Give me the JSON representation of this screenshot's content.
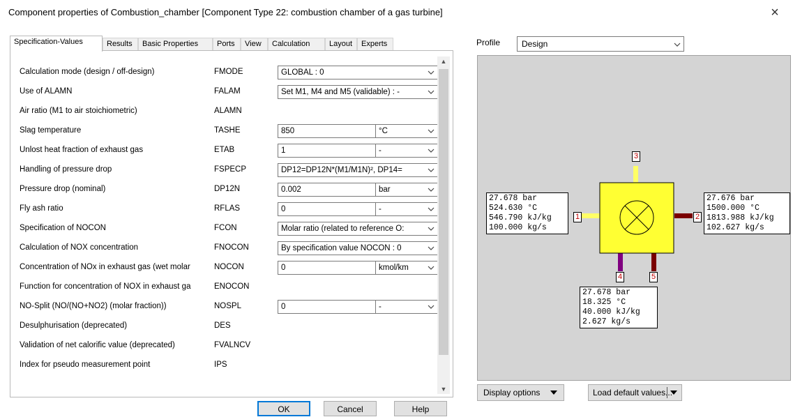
{
  "window": {
    "title": "Component properties of Combustion_chamber  [Component Type 22: combustion chamber of a gas turbine]",
    "close_glyph": "×"
  },
  "tabs": [
    {
      "label": "Specification-Values",
      "active": true
    },
    {
      "label": "Results"
    },
    {
      "label": "Basic Properties"
    },
    {
      "label": "Ports"
    },
    {
      "label": "View"
    },
    {
      "label": "Calculation"
    },
    {
      "label": "Layout"
    },
    {
      "label": "Experts"
    }
  ],
  "properties": [
    {
      "label": "Calculation mode (design / off-design)",
      "code": "FMODE",
      "value": "GLOBAL : 0",
      "kind": "combo"
    },
    {
      "label": "Use of ALAMN",
      "code": "FALAM",
      "value": "Set M1, M4 and M5 (validable) : -",
      "kind": "combo"
    },
    {
      "label": "Air ratio (M1 to air stoichiometric)",
      "code": "ALAMN",
      "value": "",
      "kind": "none"
    },
    {
      "label": "Slag temperature",
      "code": "TASHE",
      "value": "850",
      "unit": "°C",
      "kind": "unit"
    },
    {
      "label": "Unlost heat fraction of exhaust gas",
      "code": "ETAB",
      "value": "1",
      "unit": "-",
      "kind": "unit"
    },
    {
      "label": "Handling of pressure drop",
      "code": "FSPECP",
      "value": "DP12=DP12N*(M1/M1N)², DP14=",
      "kind": "combo"
    },
    {
      "label": "Pressure drop (nominal)",
      "code": "DP12N",
      "value": "0.002",
      "unit": "bar",
      "kind": "unit"
    },
    {
      "label": "Fly ash ratio",
      "code": "RFLAS",
      "value": "0",
      "unit": "-",
      "kind": "unit"
    },
    {
      "label": "Specification of NOCON",
      "code": "FCON",
      "value": "Molar ratio (related to reference O:",
      "kind": "combo"
    },
    {
      "label": "Calculation of NOX concentration",
      "code": "FNOCON",
      "value": "By specification value NOCON : 0",
      "kind": "combo"
    },
    {
      "label": "Concentration of NOx in exhaust gas (wet molar",
      "code": "NOCON",
      "value": "0",
      "unit": "kmol/km",
      "kind": "unit"
    },
    {
      "label": "Function for concentration of NOX in exhaust ga",
      "code": "ENOCON",
      "value": "",
      "kind": "none"
    },
    {
      "label": "NO-Split (NO/(NO+NO2)  (molar fraction))",
      "code": "NOSPL",
      "value": "0",
      "unit": "-",
      "kind": "unit"
    },
    {
      "label": "Desulphurisation (deprecated)",
      "code": "DES",
      "value": "",
      "kind": "none"
    },
    {
      "label": "Validation of net calorific value (deprecated)",
      "code": "FVALNCV",
      "value": "",
      "kind": "none"
    },
    {
      "label": "Index for pseudo measurement point",
      "code": "IPS",
      "value": "",
      "kind": "none"
    }
  ],
  "buttons": {
    "ok": "OK",
    "cancel": "Cancel",
    "help": "Help"
  },
  "profile": {
    "label": "Profile",
    "value": "Design"
  },
  "diagram": {
    "component_color": "#ffff33",
    "port1_box": [
      "27.678 bar",
      "524.630 °C",
      "546.790 kJ/kg",
      "100.000 kg/s"
    ],
    "port2_box": [
      "27.676 bar",
      "1500.000 °C",
      "1813.988 kJ/kg",
      "102.627 kg/s"
    ],
    "port4_box": [
      "27.678 bar",
      "18.325 °C",
      "40.000 kJ/kg",
      "2.627 kg/s"
    ],
    "port_labels": {
      "p1": "1",
      "p2": "2",
      "p3": "3",
      "p4": "4",
      "p5": "5"
    },
    "line_colors": {
      "p1": "#ffff66",
      "p2": "#7a0000",
      "p3": "#ffff66",
      "p4": "#800080",
      "p5": "#7a0000"
    }
  },
  "bottom": {
    "display_options": "Display options",
    "load_defaults": "Load default values..."
  }
}
